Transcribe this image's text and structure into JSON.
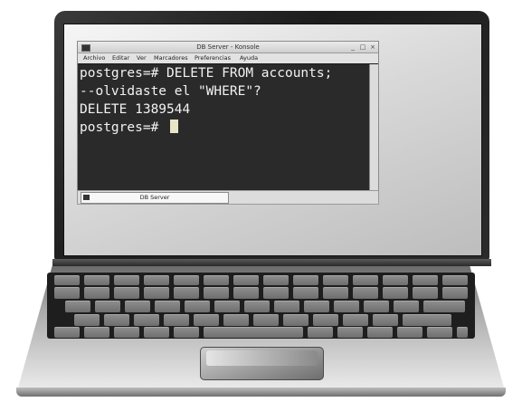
{
  "window": {
    "title": "DB Server - Konsole",
    "minimize_glyph": "_",
    "maximize_glyph": "□",
    "close_glyph": "×"
  },
  "menu": {
    "items": [
      "Archivo",
      "Editar",
      "Ver",
      "Marcadores",
      "Preferencias",
      "Ayuda"
    ]
  },
  "terminal": {
    "lines": [
      "postgres=# DELETE FROM accounts;",
      "--olvidaste el \"WHERE\"?",
      "DELETE 1389544",
      "postgres=# "
    ]
  },
  "taskbar": {
    "tab_label": "DB Server"
  },
  "icons": {
    "app": "terminal-icon",
    "tab": "terminal-icon"
  }
}
